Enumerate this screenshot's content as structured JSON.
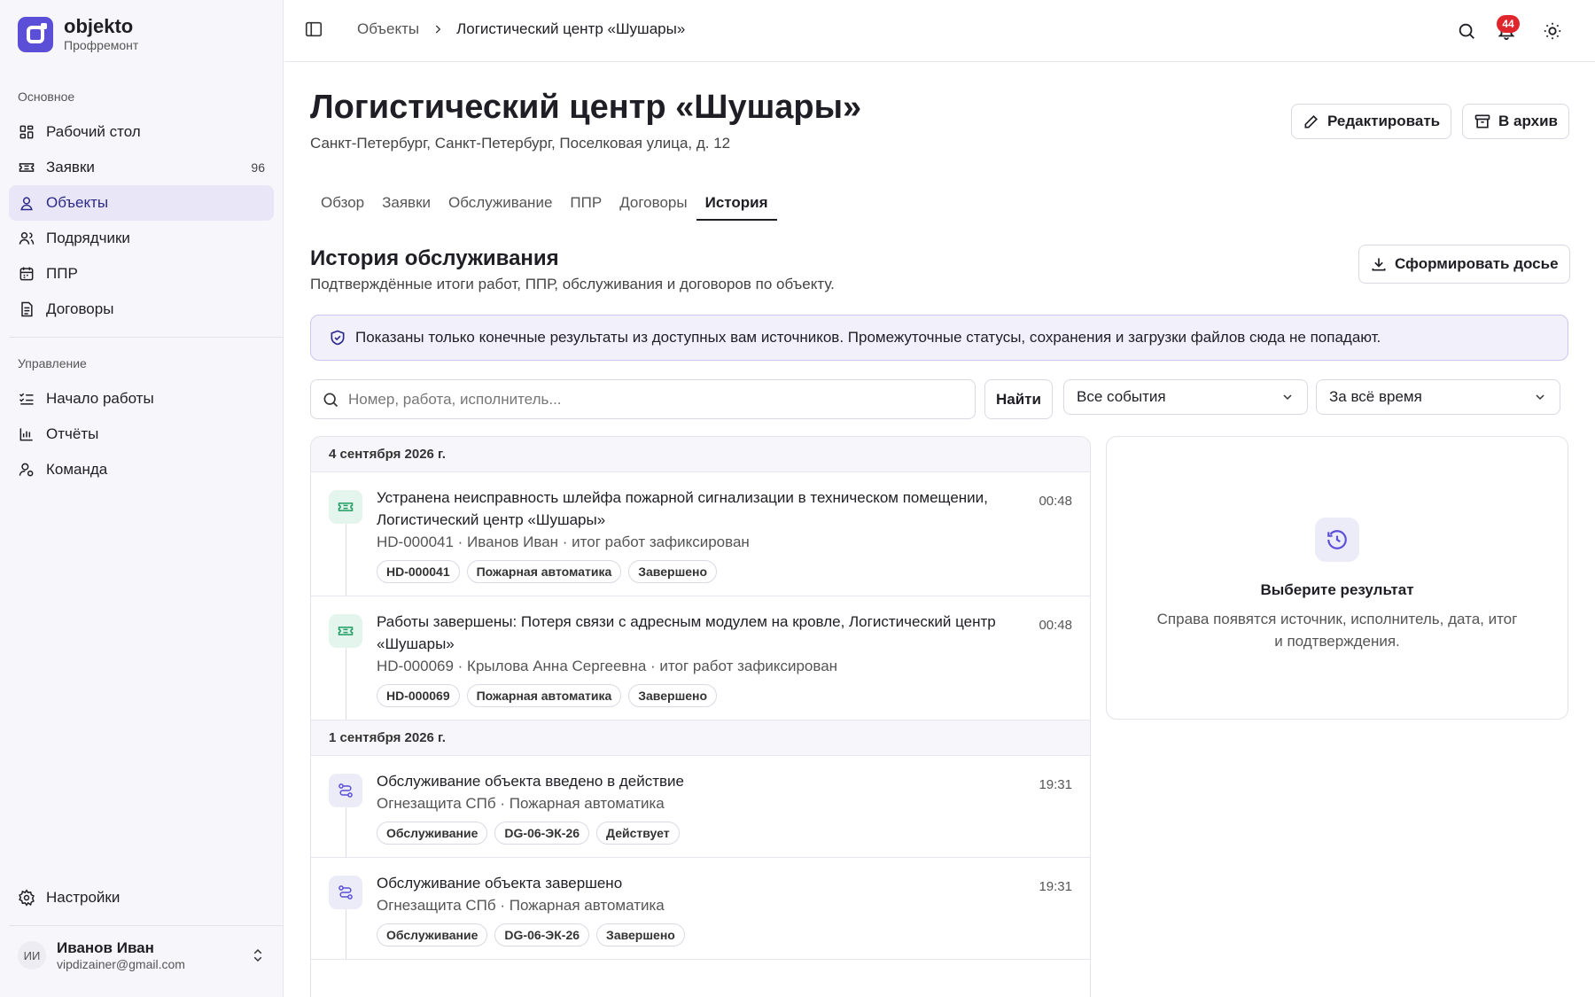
{
  "brand": {
    "name": "objekto",
    "sub": "Профремонт"
  },
  "sidebar": {
    "section_main": "Основное",
    "main_items": [
      {
        "label": "Рабочий стол",
        "icon": "dashboard-icon"
      },
      {
        "label": "Заявки",
        "icon": "ticket-icon",
        "count": "96"
      },
      {
        "label": "Объекты",
        "icon": "building-icon",
        "active": true
      },
      {
        "label": "Подрядчики",
        "icon": "users-icon"
      },
      {
        "label": "ППР",
        "icon": "calendar-icon"
      },
      {
        "label": "Договоры",
        "icon": "document-icon"
      }
    ],
    "section_manage": "Управление",
    "manage_items": [
      {
        "label": "Начало работы",
        "icon": "checklist-icon"
      },
      {
        "label": "Отчёты",
        "icon": "bar-chart-icon"
      },
      {
        "label": "Команда",
        "icon": "team-icon"
      }
    ],
    "settings": "Настройки",
    "user": {
      "initials": "ИИ",
      "name": "Иванов Иван",
      "email": "vipdizainer@gmail.com"
    }
  },
  "topbar": {
    "breadcrumb": [
      "Объекты",
      "Логистический центр «Шушары»"
    ],
    "notif_count": "44"
  },
  "header": {
    "title": "Логистический центр «Шушары»",
    "address": "Санкт-Петербург, Санкт-Петербург, Поселковая улица, д. 12",
    "edit": "Редактировать",
    "archive": "В архив"
  },
  "tabs": [
    "Обзор",
    "Заявки",
    "Обслуживание",
    "ППР",
    "Договоры",
    "История"
  ],
  "active_tab": "История",
  "history": {
    "title": "История обслуживания",
    "subtitle": "Подтверждённые итоги работ, ППР, обслуживания и договоров по объекту.",
    "dossier_btn": "Сформировать досье",
    "notice": "Показаны только конечные результаты из доступных вам источников. Промежуточные статусы, сохранения и загрузки файлов сюда не попадают.",
    "search_placeholder": "Номер, работа, исполнитель...",
    "find_btn": "Найти",
    "filter_events": "Все события",
    "filter_period": "За всё время"
  },
  "groups": [
    {
      "date": "4 сентября 2026 г.",
      "items": [
        {
          "kind": "ticket",
          "color": "#1f9d63",
          "title": "Устранена неисправность шлейфа пожарной сигнализации в техническом помещении, Логистический центр «Шушары»",
          "time": "00:48",
          "meta": "HD-000041 · Иванов Иван · итог работ зафиксирован",
          "chips": [
            "HD-000041",
            "Пожарная автоматика",
            "Завершено"
          ]
        },
        {
          "kind": "ticket",
          "color": "#1f9d63",
          "title": "Работы завершены: Потеря связи с адресным модулем на кровле, Логистический центр «Шушары»",
          "time": "00:48",
          "meta": "HD-000069 · Крылова Анна Сергеевна · итог работ зафиксирован",
          "chips": [
            "HD-000069",
            "Пожарная автоматика",
            "Завершено"
          ]
        }
      ]
    },
    {
      "date": "1 сентября 2026 г.",
      "items": [
        {
          "kind": "service",
          "color": "#5a4fd6",
          "title": "Обслуживание объекта введено в действие",
          "time": "19:31",
          "meta": "Огнезащита СПб · Пожарная автоматика",
          "chips": [
            "Обслуживание",
            "DG-06-ЭК-26",
            "Действует"
          ]
        },
        {
          "kind": "service",
          "color": "#5a4fd6",
          "title": "Обслуживание объекта завершено",
          "time": "19:31",
          "meta": "Огнезащита СПб · Пожарная автоматика",
          "chips": [
            "Обслуживание",
            "DG-06-ЭК-26",
            "Завершено"
          ]
        }
      ]
    }
  ],
  "panel": {
    "title": "Выберите результат",
    "text": "Справа появятся источник, исполнитель, дата, итог и подтверждения."
  }
}
